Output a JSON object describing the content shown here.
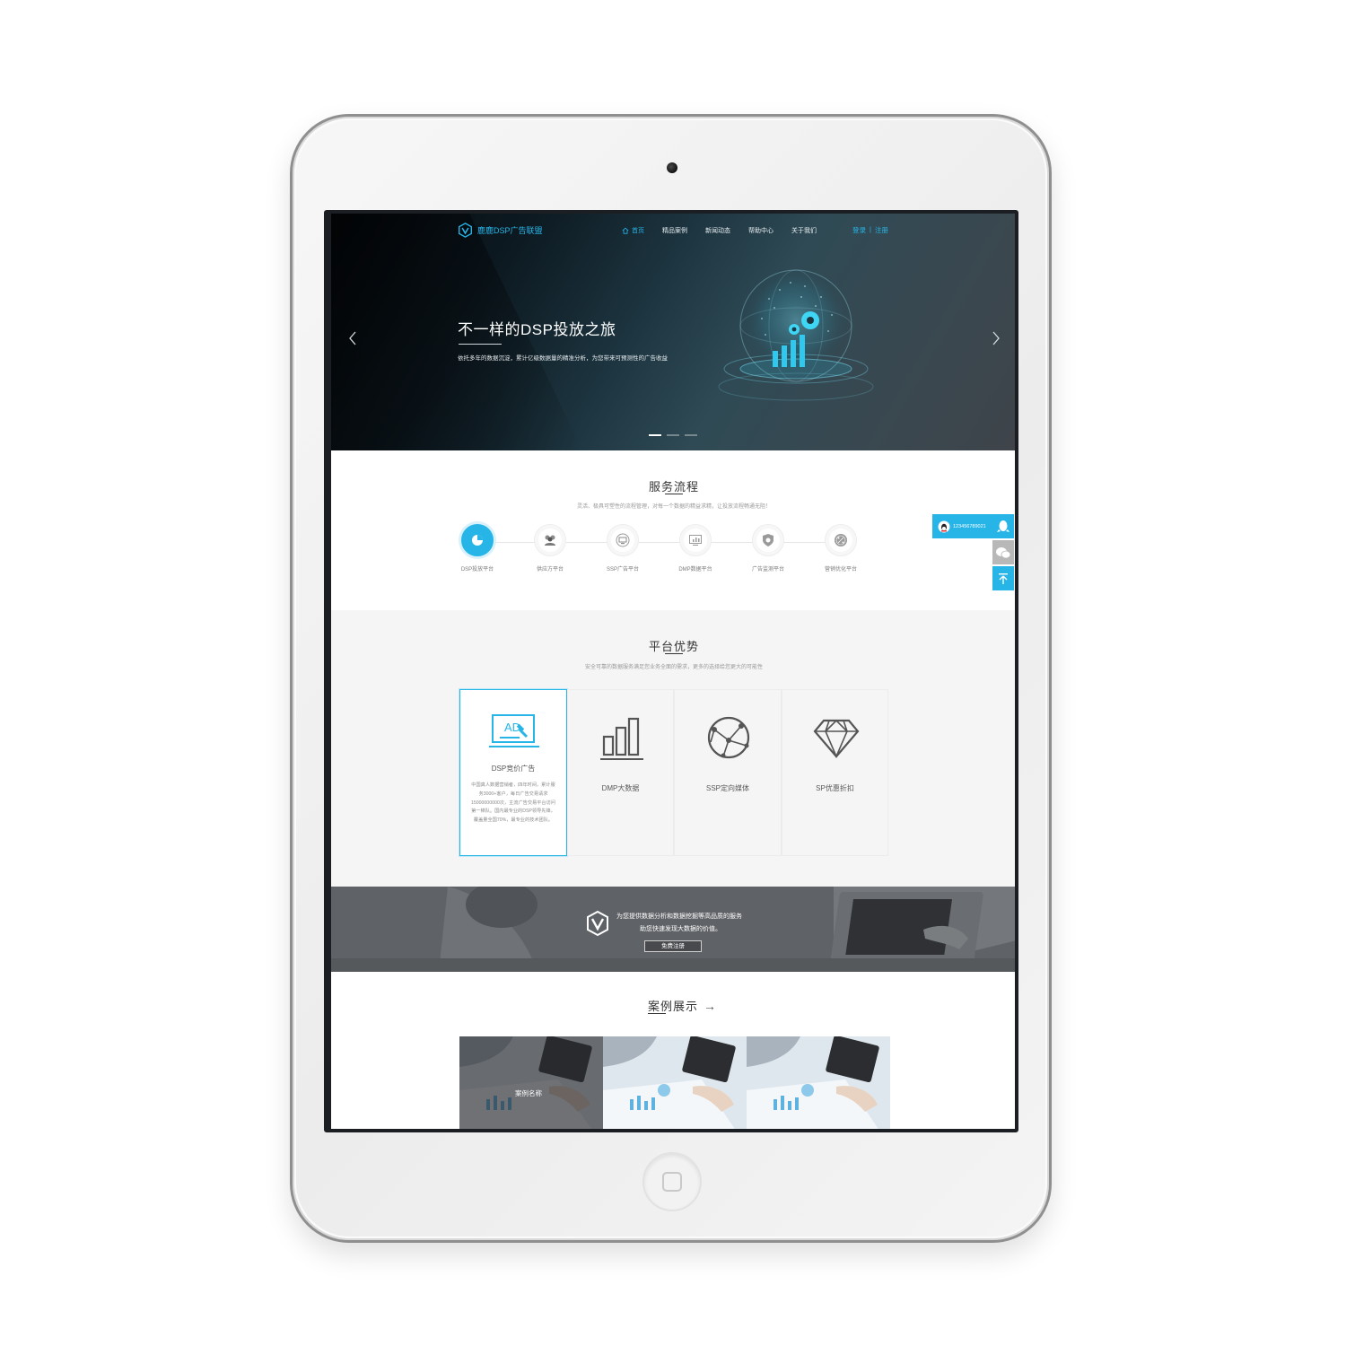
{
  "colors": {
    "accent": "#27b5e8",
    "hero_bg": "#1d3540",
    "section_gray": "#f5f5f5",
    "text_dark": "#333333"
  },
  "nav": {
    "logo_text": "鹿鹿DSP广告联盟",
    "logo_icon": "hexagon-v-logo-icon",
    "links": [
      {
        "label": "首页",
        "active": true
      },
      {
        "label": "精品案例"
      },
      {
        "label": "新闻动态"
      },
      {
        "label": "帮助中心"
      },
      {
        "label": "关于我们"
      }
    ],
    "login": "登录",
    "separator": "|",
    "register": "注册"
  },
  "hero": {
    "title": "不一样的DSP投放之旅",
    "subtitle": "依托多年的数据沉淀，累计亿级数据量的精准分析，为您带来可预测性的广告收益",
    "slide_count": 3,
    "active_slide": 0
  },
  "service": {
    "title": "服务流程",
    "subtitle": "灵活、极具可塑性的流程管理，对每一个数据的精益求精，让投放流程畅通无阻！",
    "steps": [
      {
        "label": "DSP投放平台",
        "icon": "pie-chart-icon",
        "active": true
      },
      {
        "label": "供应方平台",
        "icon": "users-icon"
      },
      {
        "label": "SSP广告平台",
        "icon": "ad-screen-icon"
      },
      {
        "label": "DMP数据平台",
        "icon": "data-monitor-icon"
      },
      {
        "label": "广告监测平台",
        "icon": "shield-icon"
      },
      {
        "label": "营销优化平台",
        "icon": "percent-badge-icon"
      }
    ]
  },
  "advantages": {
    "title": "平台优势",
    "subtitle": "安全可靠的数据服务满足您业务全面的需求，更多的选择给您更大的可能性",
    "cards": [
      {
        "name": "DSP竞价广告",
        "icon": "ad-auction-icon",
        "active": true,
        "desc": "中国真人数据营销者，四年时间，累计服务3000+客户，每日广告交易请求15000000000次，主流广告交易平台访问第一梯队。国内最专业的DSP领导先锋，覆盖量全国70%，最专业的技术团队。"
      },
      {
        "name": "DMP大数据",
        "icon": "bar-chart-icon"
      },
      {
        "name": "SSP定向媒体",
        "icon": "network-globe-icon"
      },
      {
        "name": "SP优惠折扣",
        "icon": "diamond-icon"
      }
    ]
  },
  "banner": {
    "line1": "为您提供数据分析和数据挖掘等高品质的服务",
    "line2": "助您快速发现大数据的价值。",
    "button": "免费注册"
  },
  "cases": {
    "title": "案例展示",
    "arrow": "→",
    "items": [
      {
        "name": "案例名称",
        "hover": true
      },
      {
        "name": ""
      },
      {
        "name": ""
      }
    ]
  },
  "float": {
    "qq_number": "123456789021",
    "icons": [
      "qq-penguin-icon",
      "wechat-icon",
      "back-to-top-icon"
    ]
  }
}
